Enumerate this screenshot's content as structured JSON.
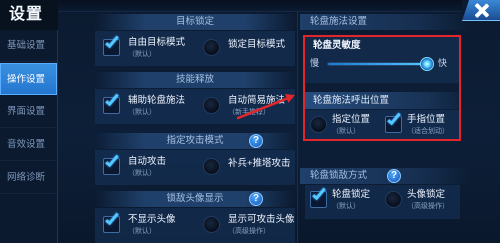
{
  "title": "设置",
  "icons": {
    "close": "close-icon",
    "help": "help-icon",
    "check": "check-icon"
  },
  "colors": {
    "accent": "#55c8ff",
    "active_tab": "#2476cf",
    "annotation": "#e3262b"
  },
  "sidebar": {
    "items": [
      {
        "label": "基础设置",
        "active": false
      },
      {
        "label": "操作设置",
        "active": true
      },
      {
        "label": "界面设置",
        "active": false
      },
      {
        "label": "音效设置",
        "active": false
      },
      {
        "label": "网络诊断",
        "active": false
      }
    ]
  },
  "left_sections": [
    {
      "header": "目标锁定",
      "options": [
        {
          "label": "自由目标模式",
          "sub": "（默认）",
          "checked": true
        },
        {
          "label": "锁定目标模式",
          "checked": false
        }
      ]
    },
    {
      "header": "技能释放",
      "options": [
        {
          "label": "辅助轮盘施法",
          "sub": "（默认）",
          "checked": true
        },
        {
          "label": "自动简易施法",
          "sub": "（新手推荐）",
          "checked": false
        }
      ]
    },
    {
      "header": "指定攻击模式",
      "help_icon": "help-icon",
      "options": [
        {
          "label": "自动攻击",
          "sub": "（默认）",
          "checked": true
        },
        {
          "label": "补兵+推塔攻击",
          "checked": false
        }
      ]
    },
    {
      "header": "锁敌头像显示",
      "help_icon": "help-icon",
      "options": [
        {
          "label": "不显示头像",
          "sub": "（默认）",
          "checked": true
        },
        {
          "label": "显示可攻击头像",
          "sub": "（高级操作）",
          "checked": false
        }
      ]
    }
  ],
  "wheel_cast": {
    "header": "轮盘施法设置",
    "sensitivity": {
      "label": "轮盘灵敏度",
      "min_label": "慢",
      "max_label": "快",
      "value": 0.97
    },
    "callout": {
      "header": "轮盘施法呼出位置",
      "options": [
        {
          "label": "指定位置",
          "sub": "（默认）",
          "checked": false
        },
        {
          "label": "手指位置",
          "sub": "（适合划动）",
          "checked": true
        }
      ]
    }
  },
  "wheel_lock": {
    "header": "轮盘锁敌方式",
    "help_icon": "help-icon",
    "options": [
      {
        "label": "轮盘锁定",
        "sub": "（默认）",
        "checked": true
      },
      {
        "label": "头像锁定",
        "sub": "（高级操作）",
        "checked": false
      }
    ]
  }
}
